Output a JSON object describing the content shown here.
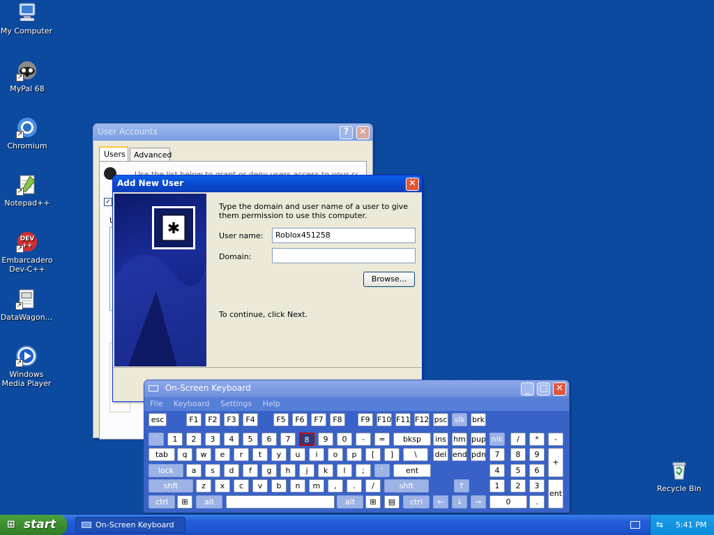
{
  "desktop": {
    "icons": [
      {
        "label": "My Computer",
        "icon": "computer-icon"
      },
      {
        "label": "MyPal 68",
        "icon": "raccoon-browser-icon"
      },
      {
        "label": "Chromium",
        "icon": "chromium-icon"
      },
      {
        "label": "Notepad++",
        "icon": "notepad-plus-icon"
      },
      {
        "label": "Embarcadero Dev-C++",
        "icon": "devcpp-icon"
      },
      {
        "label": "DataWagon...",
        "icon": "document-icon"
      },
      {
        "label": "Windows Media Player",
        "icon": "media-player-icon"
      },
      {
        "label": "Recycle Bin",
        "icon": "recycle-bin-icon"
      }
    ],
    "dev_badge": "DEV\n++"
  },
  "user_accounts": {
    "title": "User Accounts",
    "help_glyph": "?",
    "close_glyph": "✕",
    "tabs": [
      "Users",
      "Advanced"
    ],
    "intro_text": "Use the list below to grant or deny users access to your computer...",
    "label_u": "U"
  },
  "add_user": {
    "title": "Add New User",
    "close_glyph": "✕",
    "instructions": "Type the domain and user name of a user to give them permission to use this computer.",
    "username_label": "User name:",
    "username_value": "Roblox451258",
    "domain_label": "Domain:",
    "domain_value": "",
    "browse_label": "Browse...",
    "continue_text": "To continue, click Next."
  },
  "osk": {
    "title": "On-Screen Keyboard",
    "menu": [
      "File",
      "Keyboard",
      "Settings",
      "Help"
    ],
    "rows": {
      "fn": [
        "esc",
        "F1",
        "F2",
        "F3",
        "F4",
        "F5",
        "F6",
        "F7",
        "F8",
        "F9",
        "F10",
        "F11",
        "F12",
        "psc",
        "slk",
        "brk"
      ],
      "num": [
        "`",
        "1",
        "2",
        "3",
        "4",
        "5",
        "6",
        "7",
        "8",
        "9",
        "0",
        "-",
        "=",
        "bksp",
        "ins",
        "hm",
        "pup",
        "nlk",
        "/",
        "*",
        "-"
      ],
      "q": [
        "tab",
        "q",
        "w",
        "e",
        "r",
        "t",
        "y",
        "u",
        "i",
        "o",
        "p",
        "[",
        "]",
        "\\",
        "del",
        "end",
        "pdn",
        "7",
        "8",
        "9",
        "+"
      ],
      "a": [
        "lock",
        "a",
        "s",
        "d",
        "f",
        "g",
        "h",
        "j",
        "k",
        "l",
        ";",
        "'",
        "ent",
        "4",
        "5",
        "6"
      ],
      "z": [
        "shft",
        "z",
        "x",
        "c",
        "v",
        "b",
        "n",
        "m",
        ",",
        ".",
        "/",
        "shft",
        "↑",
        "1",
        "2",
        "3",
        "ent"
      ],
      "ctrl": [
        "ctrl",
        "⊞",
        "alt",
        "",
        "alt",
        "⊞",
        "▤",
        "ctrl",
        "←",
        "↓",
        "→",
        "0",
        "."
      ]
    },
    "pressed_key": "8"
  },
  "taskbar": {
    "start_label": "start",
    "task_label": "On-Screen Keyboard",
    "clock": "5:41 PM"
  },
  "colors": {
    "desktop": "#0c4aa0",
    "title_active": "#0846c9",
    "osk_body": "#3862c8"
  }
}
